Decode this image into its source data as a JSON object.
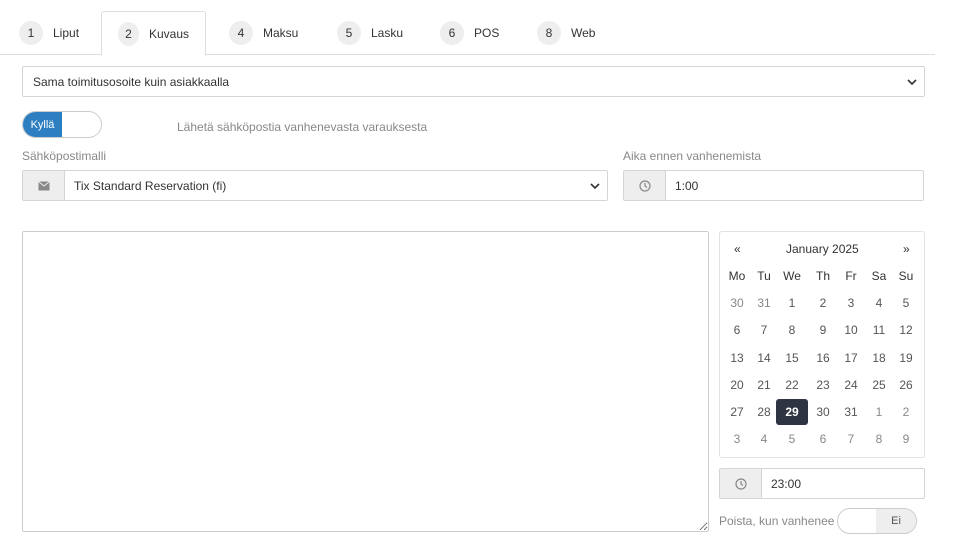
{
  "tabs": [
    {
      "num": "1",
      "label": "Liput"
    },
    {
      "num": "2",
      "label": "Kuvaus"
    },
    {
      "num": "4",
      "label": "Maksu"
    },
    {
      "num": "5",
      "label": "Lasku"
    },
    {
      "num": "6",
      "label": "POS"
    },
    {
      "num": "8",
      "label": "Web"
    }
  ],
  "active_tab": "Kuvaus",
  "address_select": {
    "value": "Sama toimitusosoite kuin asiakkaalla"
  },
  "email_toggle": {
    "on_label": "Kyllä",
    "state": "on",
    "description": "Lähetä sähköpostia vanhenevasta varauksesta"
  },
  "email_template": {
    "label": "Sähköpostimalli",
    "value": "Tix Standard Reservation (fi)",
    "icon": "envelope-icon"
  },
  "expire_before": {
    "label": "Aika ennen vanhenemista",
    "value": "1:00",
    "icon": "clock-icon"
  },
  "calendar": {
    "prev": "«",
    "next": "»",
    "month_label": "January 2025",
    "weekdays": [
      "Mo",
      "Tu",
      "We",
      "Th",
      "Fr",
      "Sa",
      "Su"
    ],
    "weeks": [
      [
        "30",
        "31",
        "1",
        "2",
        "3",
        "4",
        "5"
      ],
      [
        "6",
        "7",
        "8",
        "9",
        "10",
        "11",
        "12"
      ],
      [
        "13",
        "14",
        "15",
        "16",
        "17",
        "18",
        "19"
      ],
      [
        "20",
        "21",
        "22",
        "23",
        "24",
        "25",
        "26"
      ],
      [
        "27",
        "28",
        "29",
        "30",
        "31",
        "1",
        "2"
      ],
      [
        "3",
        "4",
        "5",
        "6",
        "7",
        "8",
        "9"
      ]
    ],
    "selected": "29"
  },
  "time_field": {
    "value": "23:00",
    "icon": "clock-icon"
  },
  "delete_toggle": {
    "label": "Poista, kun vanhenee",
    "off_label": "Ei",
    "state": "off"
  },
  "colors": {
    "accent": "#2d7fc1",
    "selected_day": "#2e3440"
  }
}
